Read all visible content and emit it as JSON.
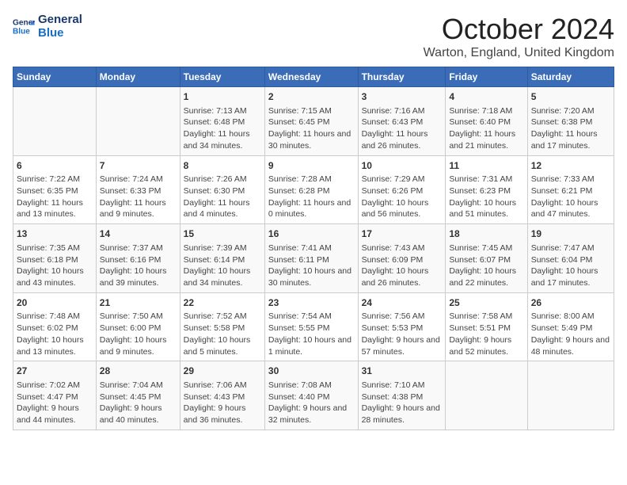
{
  "logo": {
    "line1": "General",
    "line2": "Blue"
  },
  "title": "October 2024",
  "location": "Warton, England, United Kingdom",
  "days_of_week": [
    "Sunday",
    "Monday",
    "Tuesday",
    "Wednesday",
    "Thursday",
    "Friday",
    "Saturday"
  ],
  "weeks": [
    [
      {
        "day": "",
        "content": ""
      },
      {
        "day": "",
        "content": ""
      },
      {
        "day": "1",
        "content": "Sunrise: 7:13 AM\nSunset: 6:48 PM\nDaylight: 11 hours and 34 minutes."
      },
      {
        "day": "2",
        "content": "Sunrise: 7:15 AM\nSunset: 6:45 PM\nDaylight: 11 hours and 30 minutes."
      },
      {
        "day": "3",
        "content": "Sunrise: 7:16 AM\nSunset: 6:43 PM\nDaylight: 11 hours and 26 minutes."
      },
      {
        "day": "4",
        "content": "Sunrise: 7:18 AM\nSunset: 6:40 PM\nDaylight: 11 hours and 21 minutes."
      },
      {
        "day": "5",
        "content": "Sunrise: 7:20 AM\nSunset: 6:38 PM\nDaylight: 11 hours and 17 minutes."
      }
    ],
    [
      {
        "day": "6",
        "content": "Sunrise: 7:22 AM\nSunset: 6:35 PM\nDaylight: 11 hours and 13 minutes."
      },
      {
        "day": "7",
        "content": "Sunrise: 7:24 AM\nSunset: 6:33 PM\nDaylight: 11 hours and 9 minutes."
      },
      {
        "day": "8",
        "content": "Sunrise: 7:26 AM\nSunset: 6:30 PM\nDaylight: 11 hours and 4 minutes."
      },
      {
        "day": "9",
        "content": "Sunrise: 7:28 AM\nSunset: 6:28 PM\nDaylight: 11 hours and 0 minutes."
      },
      {
        "day": "10",
        "content": "Sunrise: 7:29 AM\nSunset: 6:26 PM\nDaylight: 10 hours and 56 minutes."
      },
      {
        "day": "11",
        "content": "Sunrise: 7:31 AM\nSunset: 6:23 PM\nDaylight: 10 hours and 51 minutes."
      },
      {
        "day": "12",
        "content": "Sunrise: 7:33 AM\nSunset: 6:21 PM\nDaylight: 10 hours and 47 minutes."
      }
    ],
    [
      {
        "day": "13",
        "content": "Sunrise: 7:35 AM\nSunset: 6:18 PM\nDaylight: 10 hours and 43 minutes."
      },
      {
        "day": "14",
        "content": "Sunrise: 7:37 AM\nSunset: 6:16 PM\nDaylight: 10 hours and 39 minutes."
      },
      {
        "day": "15",
        "content": "Sunrise: 7:39 AM\nSunset: 6:14 PM\nDaylight: 10 hours and 34 minutes."
      },
      {
        "day": "16",
        "content": "Sunrise: 7:41 AM\nSunset: 6:11 PM\nDaylight: 10 hours and 30 minutes."
      },
      {
        "day": "17",
        "content": "Sunrise: 7:43 AM\nSunset: 6:09 PM\nDaylight: 10 hours and 26 minutes."
      },
      {
        "day": "18",
        "content": "Sunrise: 7:45 AM\nSunset: 6:07 PM\nDaylight: 10 hours and 22 minutes."
      },
      {
        "day": "19",
        "content": "Sunrise: 7:47 AM\nSunset: 6:04 PM\nDaylight: 10 hours and 17 minutes."
      }
    ],
    [
      {
        "day": "20",
        "content": "Sunrise: 7:48 AM\nSunset: 6:02 PM\nDaylight: 10 hours and 13 minutes."
      },
      {
        "day": "21",
        "content": "Sunrise: 7:50 AM\nSunset: 6:00 PM\nDaylight: 10 hours and 9 minutes."
      },
      {
        "day": "22",
        "content": "Sunrise: 7:52 AM\nSunset: 5:58 PM\nDaylight: 10 hours and 5 minutes."
      },
      {
        "day": "23",
        "content": "Sunrise: 7:54 AM\nSunset: 5:55 PM\nDaylight: 10 hours and 1 minute."
      },
      {
        "day": "24",
        "content": "Sunrise: 7:56 AM\nSunset: 5:53 PM\nDaylight: 9 hours and 57 minutes."
      },
      {
        "day": "25",
        "content": "Sunrise: 7:58 AM\nSunset: 5:51 PM\nDaylight: 9 hours and 52 minutes."
      },
      {
        "day": "26",
        "content": "Sunrise: 8:00 AM\nSunset: 5:49 PM\nDaylight: 9 hours and 48 minutes."
      }
    ],
    [
      {
        "day": "27",
        "content": "Sunrise: 7:02 AM\nSunset: 4:47 PM\nDaylight: 9 hours and 44 minutes."
      },
      {
        "day": "28",
        "content": "Sunrise: 7:04 AM\nSunset: 4:45 PM\nDaylight: 9 hours and 40 minutes."
      },
      {
        "day": "29",
        "content": "Sunrise: 7:06 AM\nSunset: 4:43 PM\nDaylight: 9 hours and 36 minutes."
      },
      {
        "day": "30",
        "content": "Sunrise: 7:08 AM\nSunset: 4:40 PM\nDaylight: 9 hours and 32 minutes."
      },
      {
        "day": "31",
        "content": "Sunrise: 7:10 AM\nSunset: 4:38 PM\nDaylight: 9 hours and 28 minutes."
      },
      {
        "day": "",
        "content": ""
      },
      {
        "day": "",
        "content": ""
      }
    ]
  ]
}
